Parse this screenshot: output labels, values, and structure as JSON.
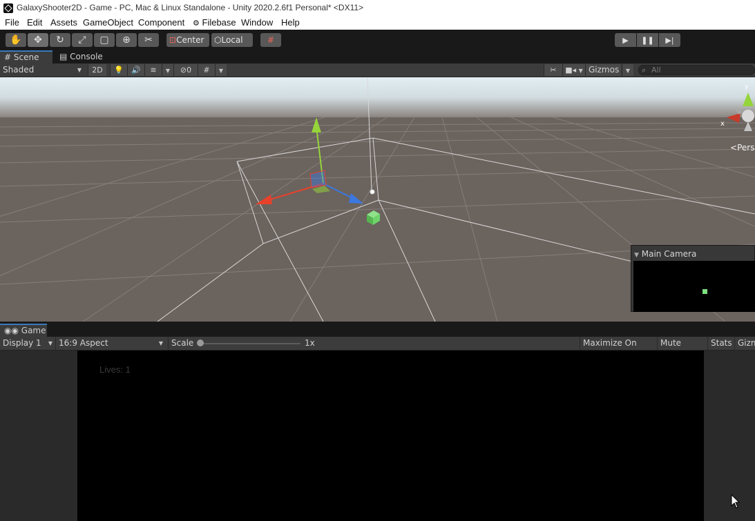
{
  "window": {
    "title": "GalaxyShooter2D - Game - PC, Mac & Linux Standalone - Unity 2020.2.6f1 Personal* <DX11>"
  },
  "menu": {
    "items": [
      "File",
      "Edit",
      "Assets",
      "GameObject",
      "Component",
      "Filebase",
      "Window",
      "Help"
    ]
  },
  "toolbar": {
    "tools": [
      "hand-icon",
      "move-icon",
      "rotate-icon",
      "scale-icon",
      "rect-icon",
      "transform-icon",
      "custom-tool-icon"
    ],
    "center_label": "Center",
    "local_label": "Local",
    "snap_icon": "grid-snap-icon",
    "play_icons": [
      "play-icon",
      "pause-icon",
      "step-icon"
    ]
  },
  "scene_tabs": {
    "scene_label": "Scene",
    "console_label": "Console"
  },
  "scene_toolbar": {
    "shading_mode": "Shaded",
    "two_d_label": "2D",
    "hidden_count": "0",
    "gizmos_label": "Gizmos",
    "search_placeholder": "All"
  },
  "scene_view": {
    "axis_x_label": "x",
    "axis_y_label": "y",
    "projection_label": "Persp"
  },
  "camera_preview": {
    "title": "Main Camera"
  },
  "game_tabs": {
    "game_label": "Game"
  },
  "game_toolbar": {
    "display": "Display 1",
    "aspect": "16:9 Aspect",
    "scale_label": "Scale",
    "scale_value": "1x",
    "scale_fraction": 0.0,
    "maximize_label": "Maximize On Play",
    "mute_label": "Mute Audio",
    "stats_label": "Stats",
    "gizmos_label": "Gizmos"
  },
  "game_view": {
    "lives_text": "Lives: 1"
  },
  "colors": {
    "scene_ground": "#6d6460",
    "scene_sky": "#e9f3f6",
    "x_axis": "#e8412b",
    "y_axis": "#95d43b",
    "z_axis": "#3b78e0",
    "cube": "#6ed46a"
  }
}
